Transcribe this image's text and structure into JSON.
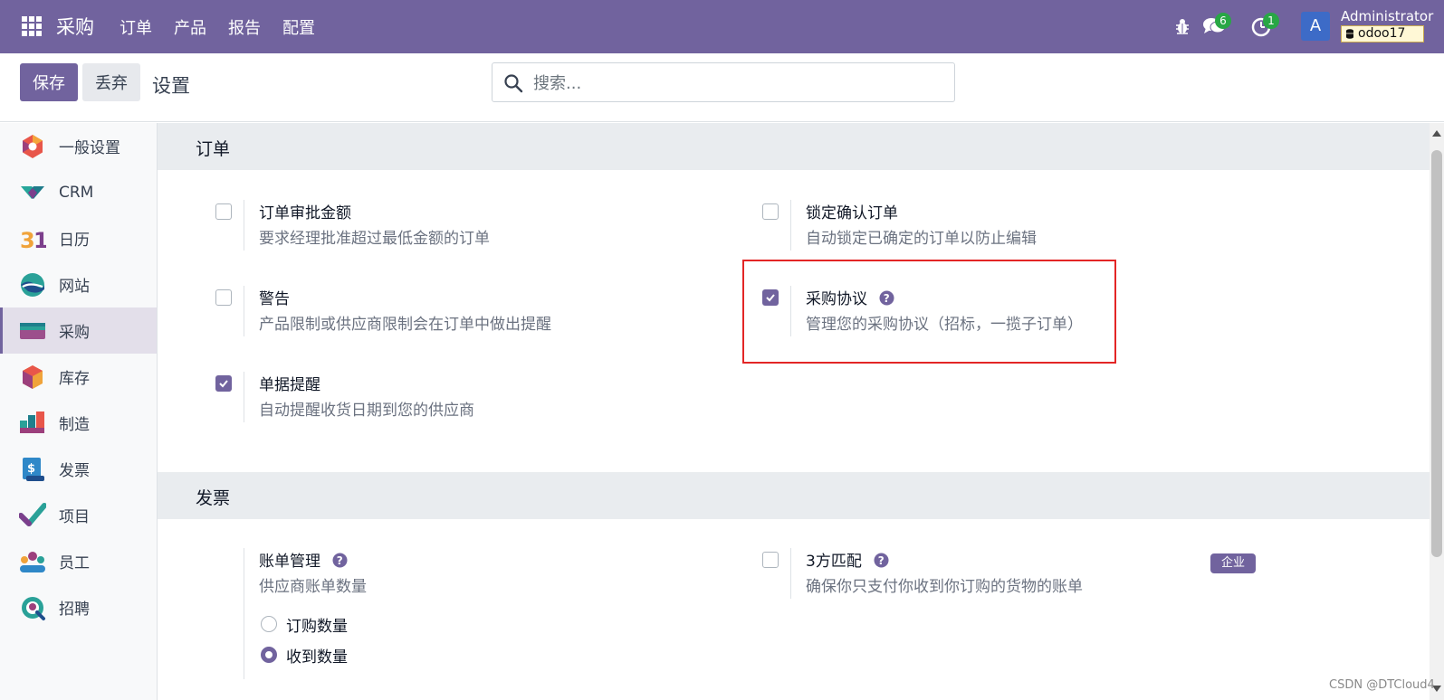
{
  "navbar": {
    "brand": "采购",
    "menu": [
      "订单",
      "产品",
      "报告",
      "配置"
    ],
    "messages_count": "6",
    "activities_count": "1",
    "avatar_letter": "A",
    "user_name": "Administrator",
    "database": "odoo17"
  },
  "control": {
    "save_label": "保存",
    "discard_label": "丢弃",
    "title": "设置",
    "search_placeholder": "搜索..."
  },
  "sidebar": {
    "items": [
      {
        "label": "一般设置",
        "icon": "general-settings-icon"
      },
      {
        "label": "CRM",
        "icon": "crm-icon"
      },
      {
        "label": "日历",
        "icon": "calendar-icon"
      },
      {
        "label": "网站",
        "icon": "website-icon"
      },
      {
        "label": "采购",
        "icon": "purchase-icon",
        "active": true
      },
      {
        "label": "库存",
        "icon": "inventory-icon"
      },
      {
        "label": "制造",
        "icon": "manufacturing-icon"
      },
      {
        "label": "发票",
        "icon": "invoicing-icon"
      },
      {
        "label": "项目",
        "icon": "project-icon"
      },
      {
        "label": "员工",
        "icon": "employees-icon"
      },
      {
        "label": "招聘",
        "icon": "recruitment-icon"
      }
    ]
  },
  "sections": {
    "orders": {
      "title": "订单",
      "settings": {
        "approval": {
          "title": "订单审批金额",
          "desc": "要求经理批准超过最低金额的订单",
          "checked": false
        },
        "lock": {
          "title": "锁定确认订单",
          "desc": "自动锁定已确定的订单以防止编辑",
          "checked": false
        },
        "warning": {
          "title": "警告",
          "desc": "产品限制或供应商限制会在订单中做出提醒",
          "checked": false
        },
        "agreements": {
          "title": "采购协议",
          "desc": "管理您的采购协议（招标，一揽子订单）",
          "checked": true
        },
        "reminder": {
          "title": "单据提醒",
          "desc": "自动提醒收货日期到您的供应商",
          "checked": true
        }
      }
    },
    "invoicing": {
      "title": "发票",
      "settings": {
        "bill_control": {
          "title": "账单管理",
          "desc": "供应商账单数量",
          "options": [
            {
              "label": "订购数量",
              "selected": false
            },
            {
              "label": "收到数量",
              "selected": true
            }
          ]
        },
        "three_way": {
          "title": "3方匹配",
          "desc": "确保你只支付你收到你订购的货物的账单",
          "checked": false,
          "badge": "企业"
        }
      }
    }
  },
  "watermark": "CSDN @DTCloud4",
  "colors": {
    "primary": "#71639e",
    "badge_green": "#28a745",
    "highlight": "#e32626"
  }
}
